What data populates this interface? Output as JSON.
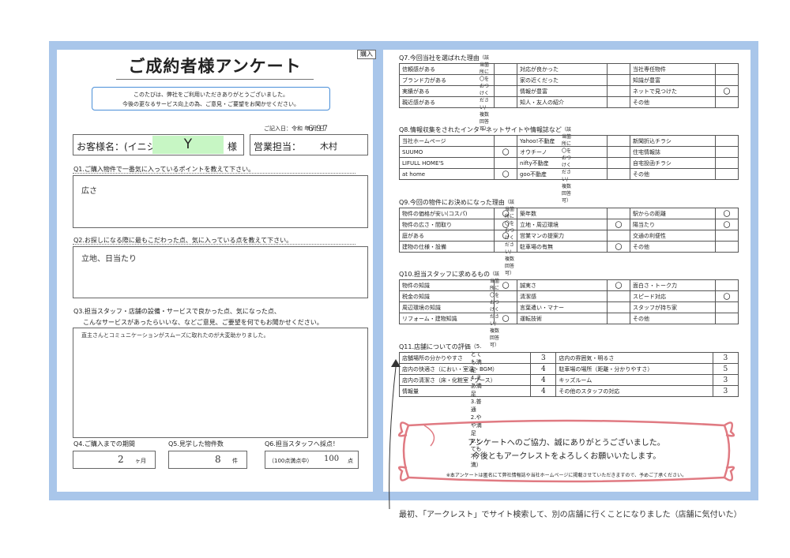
{
  "header": {
    "title": "ご成約者様アンケート",
    "tag": "購入",
    "intro_line1": "このたびは、弊社をご利用いただきありがとうございました。",
    "intro_line2": "今後の更なるサービス向上の為、ご意見・ご要望をお聞かせください。",
    "date_label": "ご記入日：令和",
    "date_year_unit": "年",
    "date_month_unit": "月",
    "date_day_unit": "日",
    "date_year": "6",
    "date_month": "9",
    "date_day": "7"
  },
  "customer": {
    "label": "お客様名：(イニシャル)",
    "initial": "Y",
    "suffix": "様",
    "staff_label": "営業担当：",
    "staff_name": "木村"
  },
  "questions": {
    "q1": "Q1.ご購入物件で一番気に入っているポイントを教えて下さい。",
    "q1_answer": "広さ",
    "q2": "Q2.お探しになる際に最もこだわった点、気に入っている点を教えて下さい。",
    "q2_answer": "立地、日当たり",
    "q3_line1": "Q3.担当スタッフ・店舗の設備・サービスで良かった点、気になった点、",
    "q3_line2": "こんなサービスがあったらいいな、などご意見、ご要望を何でもお聞かせください。",
    "q3_answer": "直主さんとコミュニケーションがスムーズに取れたのが大変助かりました。",
    "q4": "Q4.ご購入までの期間",
    "q4_answer": "2",
    "q4_unit": "ヶ月",
    "q5": "Q5.見学した物件数",
    "q5_answer": "8",
    "q5_unit": "件",
    "q6": "Q6.担当スタッフへ採点！",
    "q6_scale": "（100点満点中）",
    "q6_answer": "100",
    "q6_unit": "点"
  },
  "right": {
    "q7": "Q7.今回当社を選ばれた理由",
    "q7_note": "（該当箇所に〇をおつけください/複数回答可）",
    "q7_rows": [
      [
        "信頼感がある",
        "",
        "対応が良かった",
        "",
        "当社専任物件",
        ""
      ],
      [
        "ブランド力がある",
        "",
        "家の近くだった",
        "",
        "知識が豊富",
        ""
      ],
      [
        "実績がある",
        "",
        "情報が豊富",
        "",
        "ネットで見つけた",
        "〇"
      ],
      [
        "親近感がある",
        "",
        "知人・友人の紹介",
        "",
        "その他",
        ""
      ]
    ],
    "q8": "Q8.情報収集をされたインターネットサイトや情報誌など",
    "q8_note": "（該当箇所に〇をおつけください/複数回答可）",
    "q8_rows": [
      [
        "当社ホームページ",
        "",
        "Yahoo!不動産",
        "",
        "新聞折込チラシ",
        ""
      ],
      [
        "SUUMO",
        "〇",
        "オウチーノ",
        "",
        "住宅情報誌",
        ""
      ],
      [
        "LIFULL HOME'S",
        "",
        "nifty不動産",
        "",
        "自宅投函チラシ",
        ""
      ],
      [
        "at home",
        "〇",
        "goo不動産",
        "",
        "その他",
        ""
      ]
    ],
    "q9": "Q9.今回の物件にお決めになった理由",
    "q9_note": "（該当箇所に〇をおつけください/複数回答可）",
    "q9_rows": [
      [
        "物件の価格が安い(コスパ)",
        "〇",
        "築年数",
        "",
        "駅からの距離",
        "〇"
      ],
      [
        "物件の広さ・間取り",
        "〇",
        "立地・周辺環境",
        "〇",
        "陽当たり",
        "〇"
      ],
      [
        "庭がある",
        "〇",
        "営業マンの提案力",
        "",
        "交通の利便性",
        ""
      ],
      [
        "建物の仕様・設備",
        "",
        "駐車場の有無",
        "〇",
        "その他",
        ""
      ]
    ],
    "q10": "Q10.担当スタッフに求めるもの",
    "q10_note": "（該当箇所に〇をおつけください/複数回答可）",
    "q10_rows": [
      [
        "物件の知識",
        "〇",
        "誠実さ",
        "〇",
        "面白さ・トーク力",
        ""
      ],
      [
        "税金の知識",
        "",
        "清潔感",
        "",
        "スピード対応",
        "〇"
      ],
      [
        "周辺環境の知識",
        "",
        "言葉遣い・マナー",
        "",
        "スタッフが持ち家",
        ""
      ],
      [
        "リフォーム・建物知識",
        "〇",
        "運転技術",
        "",
        "その他",
        ""
      ]
    ],
    "q11": "Q11.店舗についての評価",
    "q11_scale": "（5.とても満足　4.まあ満足　3.普通　2.やや満足　1.とても不満）",
    "q11_rows": [
      [
        "店舗場所の分かりやすさ",
        "3",
        "店内の雰囲気・明るさ",
        "3"
      ],
      [
        "店内の快適さ（におい・室温・BGM）",
        "4",
        "駐車場の場所（距離・分かりやすさ）",
        "5"
      ],
      [
        "店内の清潔さ（床・化粧室・ブース）",
        "4",
        "キッズルーム",
        "3"
      ],
      [
        "情報量",
        "4",
        "その他のスタッフの対応",
        "3"
      ]
    ],
    "thanks_line1": "アンケートへのご協力、誠にありがとうございました。",
    "thanks_line2": "今後ともアークレストをよろしくお願いいたします。",
    "disclaimer": "※本アンケートは匿名にて弊社情報誌や当社ホームページに掲載させていただきますので、予めご了承ください。"
  },
  "footnote": "最初、「アークレスト」でサイト検索して、別の店舗に行くことになりました（店舗に気付いた）",
  "colors": {
    "frame": "#a9c6ea",
    "intro_border": "#4a8fd8",
    "name_highlight": "#c7f6c4",
    "ribbon": "#e07a82"
  }
}
